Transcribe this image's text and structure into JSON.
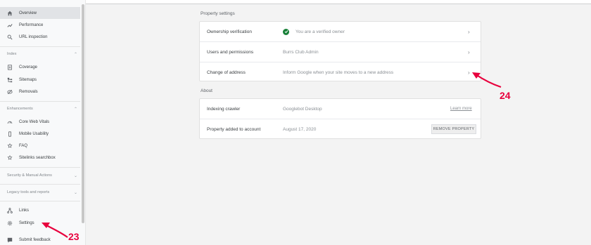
{
  "sidebar": {
    "items_top": [
      {
        "label": "Overview",
        "icon": "home-icon",
        "active": true
      },
      {
        "label": "Performance",
        "icon": "trending-up-icon"
      },
      {
        "label": "URL inspection",
        "icon": "search-icon"
      }
    ],
    "index": {
      "heading": "Index",
      "items": [
        {
          "label": "Coverage",
          "icon": "coverage-icon"
        },
        {
          "label": "Sitemaps",
          "icon": "sitemaps-icon"
        },
        {
          "label": "Removals",
          "icon": "removals-icon"
        }
      ]
    },
    "enhancements": {
      "heading": "Enhancements",
      "items": [
        {
          "label": "Core Web Vitals",
          "icon": "speed-icon"
        },
        {
          "label": "Mobile Usability",
          "icon": "mobile-icon"
        },
        {
          "label": "FAQ",
          "icon": "faq-icon"
        },
        {
          "label": "Sitelinks searchbox",
          "icon": "sitelinks-icon"
        }
      ]
    },
    "security_heading": "Security & Manual Actions",
    "legacy_heading": "Legacy tools and reports",
    "items_bottom": [
      {
        "label": "Links",
        "icon": "links-icon"
      },
      {
        "label": "Settings",
        "icon": "gear-icon"
      },
      {
        "label": "Submit feedback",
        "icon": "feedback-icon"
      }
    ]
  },
  "property_settings": {
    "title": "Property settings",
    "rows": [
      {
        "label": "Ownership verification",
        "value": "You are a verified owner"
      },
      {
        "label": "Users and permissions",
        "value": "Burrs Club Admin"
      },
      {
        "label": "Change of address",
        "value": "Inform Google when your site moves to a new address"
      }
    ]
  },
  "about": {
    "title": "About",
    "rows": [
      {
        "label": "Indexing crawler",
        "value": "Googlebot Desktop",
        "action": "Learn more"
      },
      {
        "label": "Property added to account",
        "value": "August 17, 2020",
        "action": "REMOVE PROPERTY"
      }
    ]
  },
  "annotations": {
    "settings_marker": "23",
    "address_marker": "24"
  },
  "colors": {
    "annotation": "#e8003d",
    "verified": "#188038"
  }
}
